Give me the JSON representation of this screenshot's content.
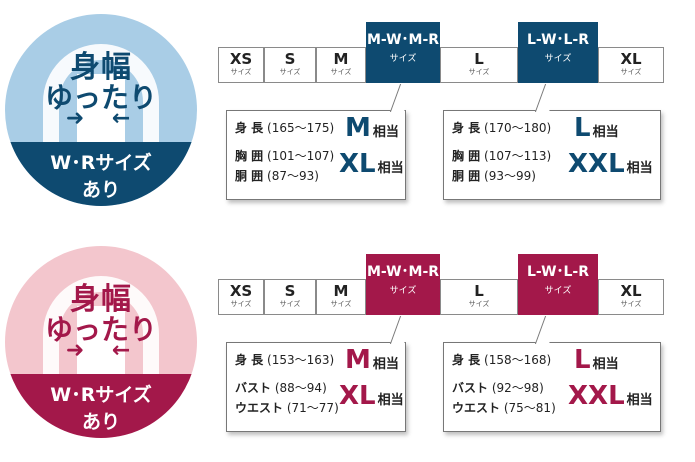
{
  "panels": [
    {
      "theme": "mens",
      "accent": "#0e4a70",
      "circle_color": "#a9cde6",
      "circle_text_color": "#0e4a70",
      "badge": {
        "line1": "身幅",
        "line2": "ゆったり",
        "arrows": "➜ ←",
        "band1": "W･Rサイズ",
        "band2": "あり"
      },
      "sizes": [
        {
          "size": "XS",
          "sub": "サイズ"
        },
        {
          "size": "S",
          "sub": "サイズ"
        },
        {
          "size": "M",
          "sub": "サイズ"
        },
        {
          "size": "M-W･M-R",
          "sub": "サイズ",
          "highlight": true
        },
        {
          "size": "L",
          "sub": "サイズ"
        },
        {
          "size": "L-W･L-R",
          "sub": "サイズ",
          "highlight": true
        },
        {
          "size": "XL",
          "sub": "サイズ"
        }
      ],
      "callouts": [
        {
          "rows": [
            {
              "label": "身 長",
              "range": "(165～175)"
            },
            {
              "label": "胸 囲",
              "range": "(101～107)"
            },
            {
              "label": "胴 囲",
              "range": "(87～93)"
            }
          ],
          "equiv1": "M",
          "equiv2": "XL",
          "suffix": "相当"
        },
        {
          "rows": [
            {
              "label": "身 長",
              "range": "(170～180)"
            },
            {
              "label": "胸 囲",
              "range": "(107～113)"
            },
            {
              "label": "胴 囲",
              "range": "(93～99)"
            }
          ],
          "equiv1": "L",
          "equiv2": "XXL",
          "suffix": "相当"
        }
      ]
    },
    {
      "theme": "womens",
      "accent": "#a3184a",
      "circle_color": "#f3c6cd",
      "circle_text_color": "#a3184a",
      "badge": {
        "line1": "身幅",
        "line2": "ゆったり",
        "arrows": "➜ ←",
        "band1": "W･Rサイズ",
        "band2": "あり"
      },
      "sizes": [
        {
          "size": "XS",
          "sub": "サイズ"
        },
        {
          "size": "S",
          "sub": "サイズ"
        },
        {
          "size": "M",
          "sub": "サイズ"
        },
        {
          "size": "M-W･M-R",
          "sub": "サイズ",
          "highlight": true
        },
        {
          "size": "L",
          "sub": "サイズ"
        },
        {
          "size": "L-W･L-R",
          "sub": "サイズ",
          "highlight": true
        },
        {
          "size": "XL",
          "sub": "サイズ"
        }
      ],
      "callouts": [
        {
          "rows": [
            {
              "label": "身 長",
              "range": "(153～163)"
            },
            {
              "label": "バスト",
              "range": "(88～94)"
            },
            {
              "label": "ウエスト",
              "range": "(71～77)"
            }
          ],
          "equiv1": "M",
          "equiv2": "XL",
          "suffix": "相当"
        },
        {
          "rows": [
            {
              "label": "身 長",
              "range": "(158～168)"
            },
            {
              "label": "バスト",
              "range": "(92～98)"
            },
            {
              "label": "ウエスト",
              "range": "(75～81)"
            }
          ],
          "equiv1": "L",
          "equiv2": "XXL",
          "suffix": "相当"
        }
      ]
    }
  ]
}
